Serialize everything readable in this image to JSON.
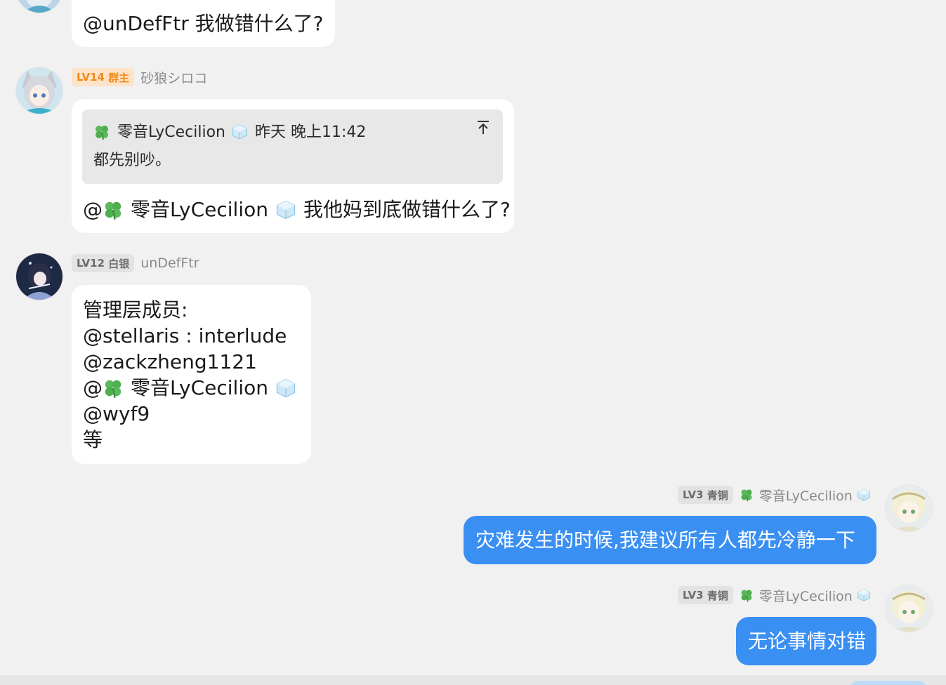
{
  "messages": [
    {
      "id": "m1",
      "text": "@unDefFtr 我做错什么了?"
    },
    {
      "id": "m2",
      "sender": {
        "level": "LV14",
        "role": "群主",
        "name": "砂狼シロコ"
      },
      "reply": {
        "author": "零音LyCecilion",
        "time": "昨天 晚上11:42",
        "text": "都先别吵。"
      },
      "mention": "@",
      "mention_name": "零音LyCecilion",
      "body": "我他妈到底做错什么了?"
    },
    {
      "id": "m3",
      "sender": {
        "level": "LV12",
        "role": "白银",
        "name": "unDefFtr"
      },
      "lines": [
        "管理层成员:",
        "@stellaris : interlude",
        "@zackzheng1121",
        "@",
        "@wyf9",
        "等"
      ],
      "line4_name": "零音LyCecilion"
    },
    {
      "id": "m4",
      "sender": {
        "level": "LV3",
        "role": "青铜",
        "name": "零音LyCecilion"
      },
      "text": "灾难发生的时候,我建议所有人都先冷静一下"
    },
    {
      "id": "m5",
      "sender": {
        "level": "LV3",
        "role": "青铜",
        "name": "零音LyCecilion"
      },
      "text": "无论事情对错"
    }
  ],
  "colors": {
    "self_bubble": "#3a8ff2",
    "owner_badge": "#f08a1c",
    "background": "#f1f1f1"
  },
  "icons": [
    "clover-icon",
    "ice-cube-icon",
    "scroll-to-top-icon"
  ]
}
